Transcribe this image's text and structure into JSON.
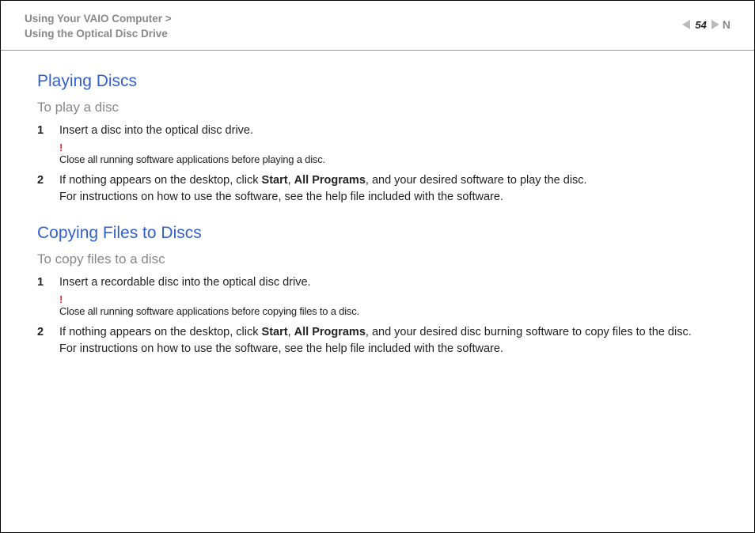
{
  "header": {
    "breadcrumb_line1": "Using Your VAIO Computer >",
    "breadcrumb_line2": "Using the Optical Disc Drive",
    "page_number": "54",
    "n_letter": "N"
  },
  "sections": [
    {
      "title": "Playing Discs",
      "subtitle": "To play a disc",
      "step1_num": "1",
      "step1_text": "Insert a disc into the optical disc drive.",
      "warn_mark": "!",
      "warn_text": "Close all running software applications before playing a disc.",
      "step2_num": "2",
      "step2_pre": "If nothing appears on the desktop, click ",
      "step2_b1": "Start",
      "step2_sep": ", ",
      "step2_b2": "All Programs",
      "step2_post": ", and your desired software to play the disc.",
      "step2_line2": "For instructions on how to use the software, see the help file included with the software."
    },
    {
      "title": "Copying Files to Discs",
      "subtitle": "To copy files to a disc",
      "step1_num": "1",
      "step1_text": "Insert a recordable disc into the optical disc drive.",
      "warn_mark": "!",
      "warn_text": "Close all running software applications before copying files to a disc.",
      "step2_num": "2",
      "step2_pre": "If nothing appears on the desktop, click ",
      "step2_b1": "Start",
      "step2_sep": ", ",
      "step2_b2": "All Programs",
      "step2_post": ", and your desired disc burning software to copy files to the disc.",
      "step2_line2": "For instructions on how to use the software, see the help file included with the software."
    }
  ]
}
